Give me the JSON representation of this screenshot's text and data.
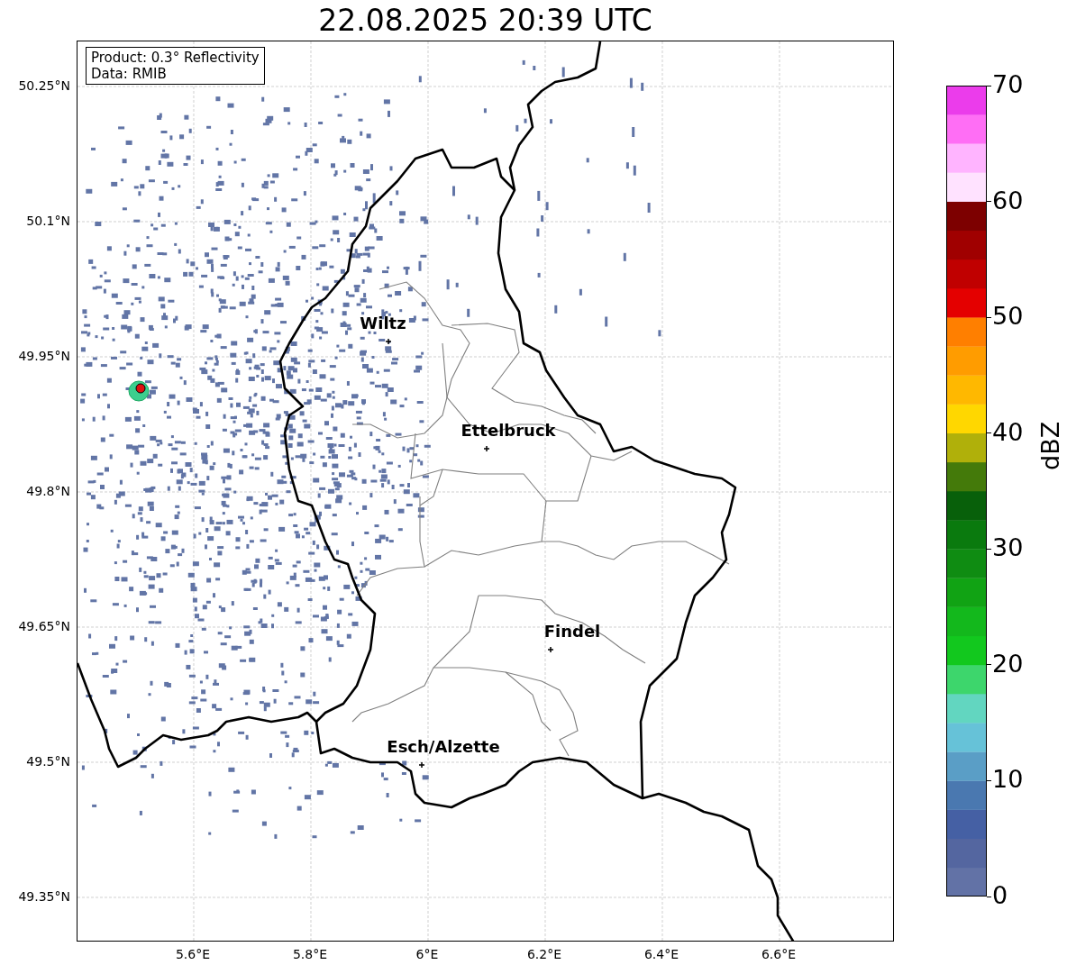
{
  "title": "22.08.2025 20:39 UTC",
  "info_box": [
    "Product: 0.3° Reflectivity",
    "Data: RMIB"
  ],
  "lat_ticks": [
    "50.25°N",
    "50.1°N",
    "49.95°N",
    "49.8°N",
    "49.65°N",
    "49.5°N",
    "49.35°N"
  ],
  "lon_ticks": [
    "5.6°E",
    "5.8°E",
    "6°E",
    "6.2°E",
    "6.4°E",
    "6.6°E"
  ],
  "cities": [
    {
      "name": "Wiltz"
    },
    {
      "name": "Ettelbruck"
    },
    {
      "name": "Findel"
    },
    {
      "name": "Esch/Alzette"
    }
  ],
  "colorbar": {
    "label": "dBZ",
    "ticks": [
      "70",
      "60",
      "50",
      "40",
      "30",
      "20",
      "10",
      "0"
    ],
    "bands": [
      {
        "color": "#6272a6"
      },
      {
        "color": "#5466a0"
      },
      {
        "color": "#4560a4"
      },
      {
        "color": "#4a78b0"
      },
      {
        "color": "#5a9ec6"
      },
      {
        "color": "#66c2d8"
      },
      {
        "color": "#62d6c0"
      },
      {
        "color": "#3dd66c"
      },
      {
        "color": "#12c81e"
      },
      {
        "color": "#13b81c"
      },
      {
        "color": "#11a314"
      },
      {
        "color": "#0f8c12"
      },
      {
        "color": "#0a7a0e"
      },
      {
        "color": "#08600a"
      },
      {
        "color": "#447a0a"
      },
      {
        "color": "#b0b00a"
      },
      {
        "color": "#ffd700"
      },
      {
        "color": "#ffb800"
      },
      {
        "color": "#ff9c00"
      },
      {
        "color": "#ff7f00"
      },
      {
        "color": "#e40000"
      },
      {
        "color": "#c00000"
      },
      {
        "color": "#a00000"
      },
      {
        "color": "#7d0000"
      },
      {
        "color": "#ffe2ff"
      },
      {
        "color": "#ffb4ff"
      },
      {
        "color": "#ff6ef5"
      },
      {
        "color": "#eb3ceb"
      }
    ]
  }
}
